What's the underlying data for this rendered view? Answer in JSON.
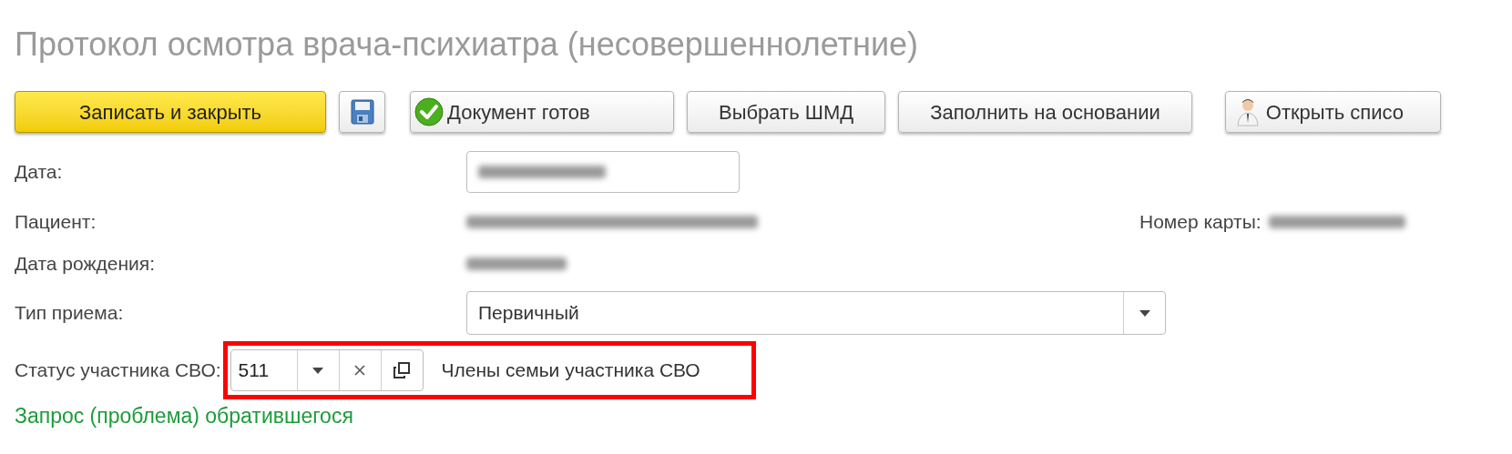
{
  "title": "Протокол осмотра врача-психиатра (несовершеннолетние)",
  "toolbar": [
    {
      "kind": "primary",
      "label": "Записать и закрыть"
    },
    {
      "kind": "save"
    },
    {
      "kind": "check",
      "label": "Документ готов"
    },
    {
      "kind": "plain",
      "label": "Выбрать ШМД"
    },
    {
      "kind": "plain",
      "label": "Заполнить на основании"
    },
    {
      "kind": "doctor",
      "label": "Открыть списо"
    }
  ],
  "fields": {
    "date_label": "Дата:",
    "patient_label": "Пациент:",
    "card_label": "Номер карты:",
    "birth_label": "Дата рождения:",
    "visit_type_label": "Тип приема:",
    "visit_type_value": "Первичный",
    "svo_label": "Статус участника СВО:",
    "svo_code": "511",
    "svo_text": "Члены семьи участника СВО"
  },
  "section_title": "Запрос (проблема) обратившегося"
}
